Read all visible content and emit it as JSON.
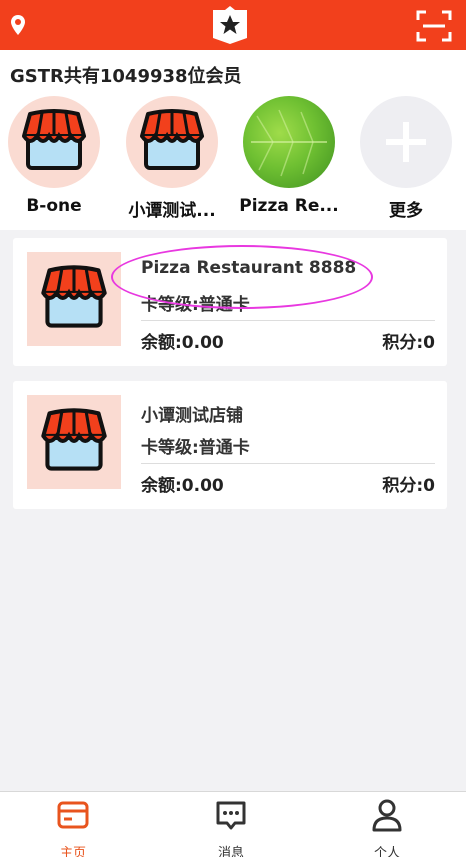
{
  "colors": {
    "accent": "#f2401c",
    "active_tab": "#e8541e"
  },
  "header": {
    "location_icon": "location-pin-icon",
    "logo_icon": "star-badge-icon",
    "scan_icon": "scan-icon"
  },
  "members": {
    "title": "GSTR共有1049938位会员",
    "shops": [
      {
        "name": "B-one"
      },
      {
        "name": "小谭测试..."
      },
      {
        "name": "Pizza Re..."
      },
      {
        "name": "更多"
      }
    ]
  },
  "cards": [
    {
      "name": "Pizza Restaurant 8888",
      "level": "卡等级:普通卡",
      "balance": "余额:0.00",
      "points": "积分:0"
    },
    {
      "name": "小谭测试店铺",
      "level": "卡等级:普通卡",
      "balance": "余额:0.00",
      "points": "积分:0"
    }
  ],
  "tabs": [
    {
      "label": "主页",
      "icon": "home-card-icon"
    },
    {
      "label": "消息",
      "icon": "message-icon"
    },
    {
      "label": "个人",
      "icon": "person-icon"
    }
  ]
}
